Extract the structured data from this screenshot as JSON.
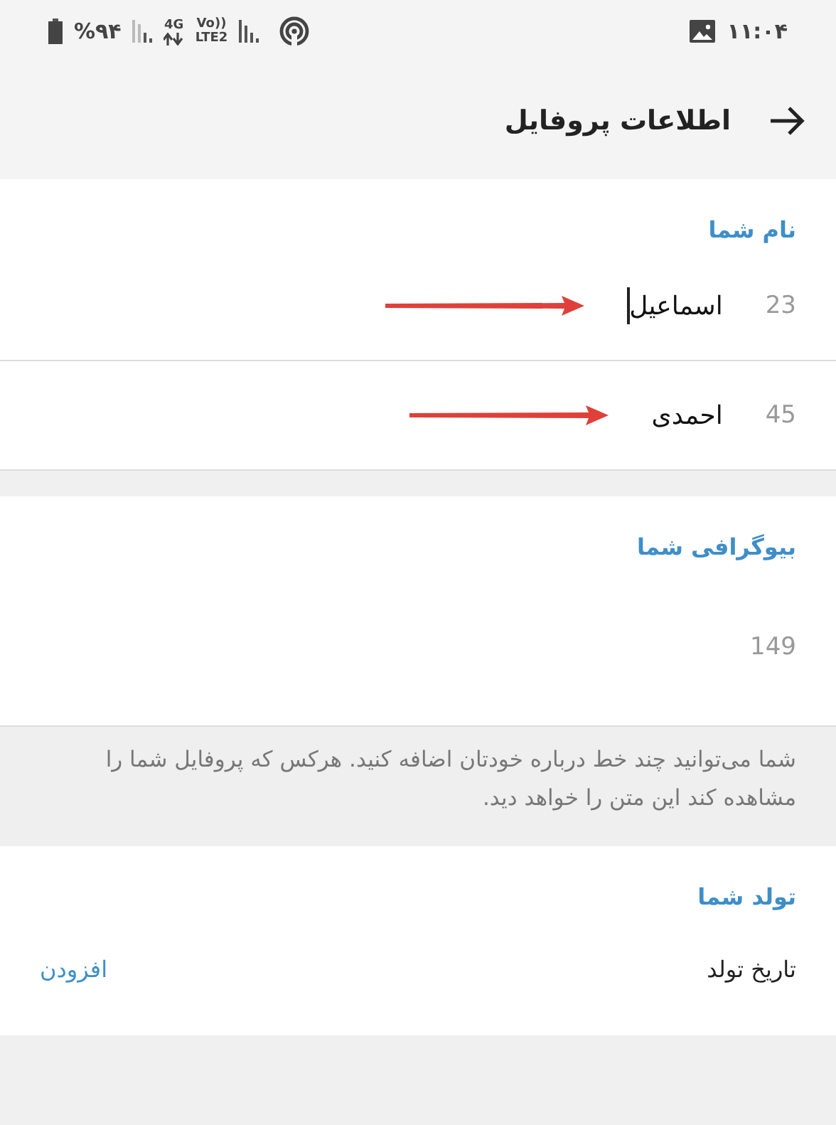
{
  "status_bar": {
    "battery": "%۹۴",
    "network": "4G",
    "volte": "Vo))",
    "lte": "LTE2",
    "time": "۱۱:۰۴"
  },
  "header": {
    "title": "اطلاعات پروفایل"
  },
  "name_section": {
    "title": "نام شما",
    "fields": [
      {
        "value": "اسماعیل",
        "counter": "23",
        "focused": true,
        "annotated": true
      },
      {
        "value": "احمدی",
        "counter": "45",
        "focused": false,
        "annotated": true
      }
    ]
  },
  "bio_section": {
    "title": "بیوگرافی شما",
    "counter": "149",
    "hint": "شما می‌توانید چند خط درباره خودتان اضافه کنید. هرکس که پروفایل شما را مشاهده کند این متن را خواهد دید."
  },
  "birthday_section": {
    "title": "تولد شما",
    "label": "تاریخ تولد",
    "action": "افزودن"
  }
}
